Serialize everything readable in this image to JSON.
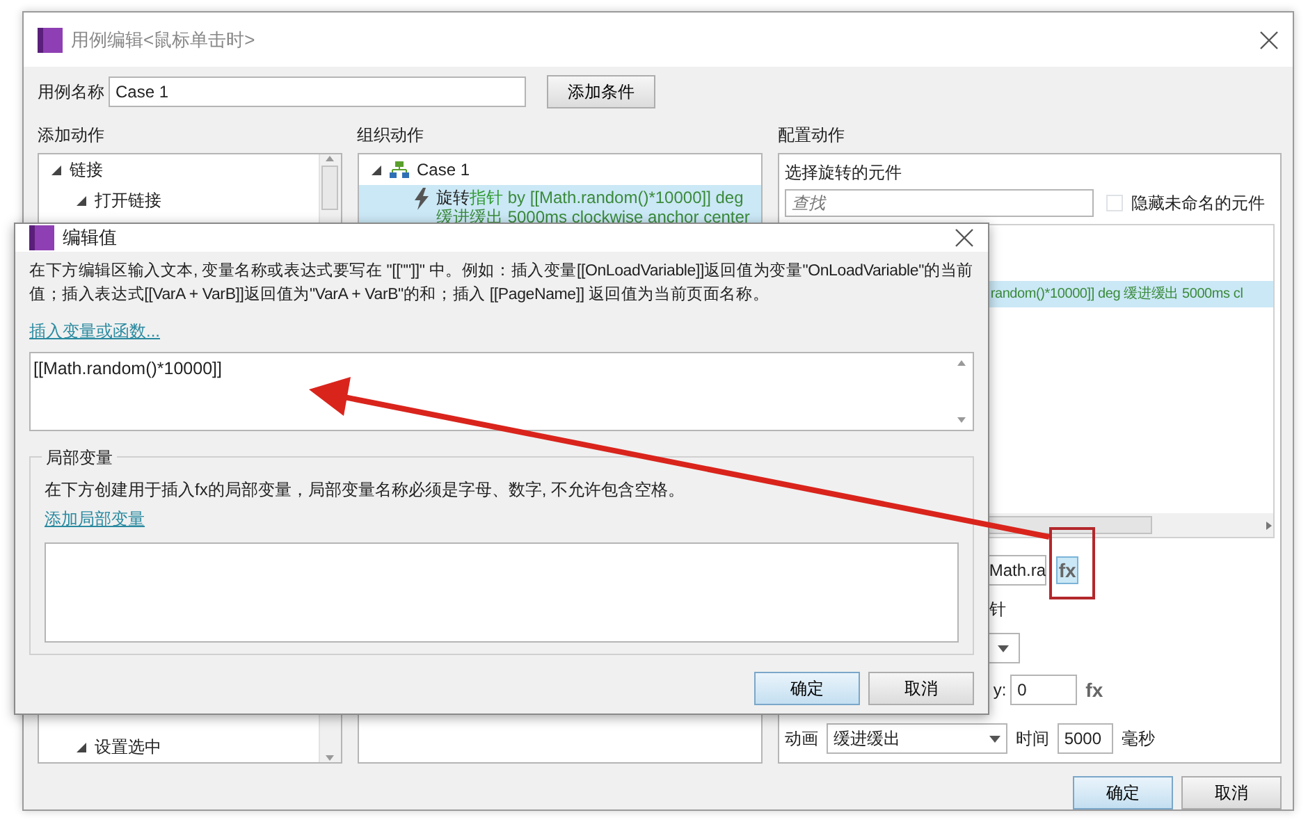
{
  "window": {
    "title": "用例编辑<鼠标单击时>"
  },
  "case_name": {
    "label": "用例名称",
    "value": "Case 1",
    "button": "添加条件"
  },
  "add_actions": {
    "heading": "添加动作",
    "tree": [
      {
        "label": "链接",
        "expanded": true,
        "children": [
          {
            "label": "打开链接",
            "expanded": true
          }
        ]
      }
    ],
    "tree_bottom": [
      {
        "label": "设置选中",
        "expanded": true
      }
    ]
  },
  "organize_actions": {
    "heading": "组织动作",
    "cases": [
      {
        "label": "Case 1",
        "expanded": true,
        "actions": [
          {
            "selected": true,
            "segments": [
              {
                "kind": "plain",
                "text": "旋转"
              },
              {
                "kind": "target",
                "text": "指针"
              },
              {
                "kind": "detail",
                "text": " by [[Math.random()*10000]] deg 缓进缓出 5000ms clockwise anchor center"
              }
            ]
          }
        ]
      }
    ]
  },
  "configure": {
    "heading": "配置动作",
    "subheading": "选择旋转的元件",
    "search": {
      "placeholder": "查找"
    },
    "hide_unnamed": {
      "label": "隐藏未命名的元件",
      "checked": false
    },
    "list_rows": [
      {
        "text": "random()*10000]] deg 缓进缓出 5000ms cl",
        "selected": true
      }
    ],
    "angle": {
      "value": "Math.ra",
      "fx": "fx",
      "highlighted": true
    },
    "direction_text": "针",
    "y": {
      "label": "y:",
      "value": "0",
      "fx": "fx"
    },
    "animation": {
      "label": "动画",
      "value": "缓进缓出",
      "time_label": "时间",
      "time": "5000",
      "unit": "毫秒"
    }
  },
  "buttons": [
    "确定",
    "取消"
  ],
  "dialog": {
    "title": "编辑值",
    "description": "在下方编辑区输入文本, 变量名称或表达式要写在 \"[[\"\"]]\" 中。例如：插入变量[[OnLoadVariable]]返回值为变量\"OnLoadVariable\"的当前值；插入表达式[[VarA + VarB]]返回值为\"VarA + VarB\"的和；插入 [[PageName]] 返回值为当前页面名称。",
    "insert_link": "插入变量或函数...",
    "value": "[[Math.random()*10000]]",
    "locals": {
      "legend": "局部变量",
      "hint": "在下方创建用于插入fx的局部变量，局部变量名称必须是字母、数字, 不允许包含空格。",
      "add_link": "添加局部变量"
    },
    "buttons": [
      {
        "label": "确定",
        "default": true
      },
      {
        "label": "取消",
        "default": false
      }
    ]
  },
  "annotations": [
    {
      "kind": "arrow"
    },
    {
      "kind": "frame"
    }
  ]
}
